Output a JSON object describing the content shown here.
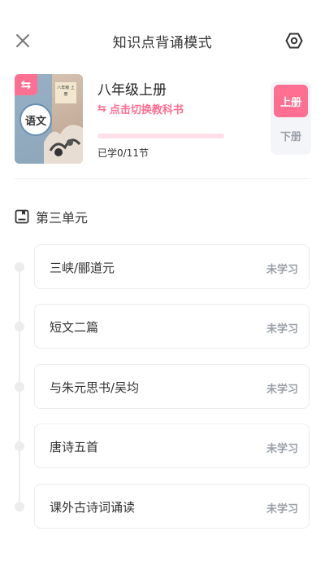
{
  "header": {
    "title": "知识点背诵模式",
    "close_icon": "close-icon",
    "settings_icon": "hexagon-settings-icon"
  },
  "book": {
    "name": "八年级上册",
    "switch_label": "点击切换教科书",
    "switch_icon": "swap-arrows-icon",
    "progress_text": "已学0/11节",
    "progress_fraction": 0.0,
    "cover": {
      "badge_icon": "swap-arrows-icon",
      "seal_text": "语文",
      "tag_text": "八年级 上册"
    },
    "volumes": [
      {
        "label": "上册",
        "active": true
      },
      {
        "label": "下册",
        "active": false
      }
    ]
  },
  "unit": {
    "title": "第三单元",
    "icon": "book-icon"
  },
  "lessons": [
    {
      "name": "三峡/郦道元",
      "status": "未学习"
    },
    {
      "name": "短文二篇",
      "status": "未学习"
    },
    {
      "name": "与朱元思书/吴均",
      "status": "未学习"
    },
    {
      "name": "唐诗五首",
      "status": "未学习"
    },
    {
      "name": "课外古诗词诵读",
      "status": "未学习"
    }
  ],
  "colors": {
    "accent": "#ff6f91",
    "accent_light": "#fde0e8",
    "muted": "#9aa0a8",
    "border": "#ececec"
  }
}
